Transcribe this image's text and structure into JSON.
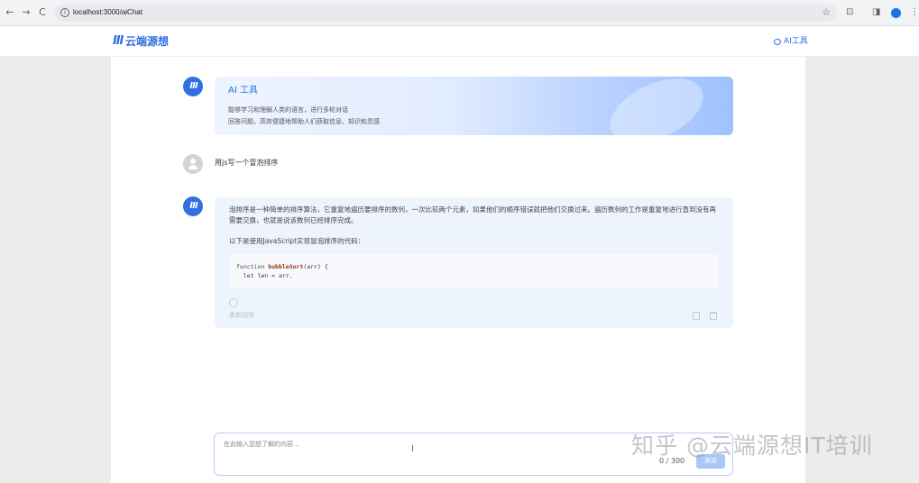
{
  "browser": {
    "url": "localhost:3000/aiChat",
    "back": "←",
    "forward": "→",
    "reload": "C",
    "info": "i",
    "star": "☆",
    "extensions": "⊡",
    "sidebar": "◨",
    "menu": "⋮"
  },
  "header": {
    "logo_mark": "Ⅲ",
    "logo_text": "云端源想",
    "nav_link": "AI工具"
  },
  "chat": {
    "ai_avatar": "Ⅲ",
    "intro": {
      "title": "AI 工具",
      "line1": "能够学习和理解人类的语言，进行多轮对话",
      "line2": "回答问题，高效便捷地帮助人们获取信息、知识和灵感"
    },
    "user_message": "用js写一个冒泡排序",
    "answer": {
      "paragraph1": "泡排序是一种简单的排序算法，它重复地遍历要排序的数列，一次比较两个元素，如果他们的顺序错误就把他们交换过来。遍历数列的工作是重复地进行直到没有再需要交换，也就是说该数列已经排序完成。",
      "paragraph2": "以下是使用JavaScript实现冒泡排序的代码：",
      "code_line1_kw": "function ",
      "code_line1_fn": "bubbleSort",
      "code_line1_rest": "(arr) {",
      "code_line2": "  let len = arr.",
      "regenerate": "重新回答"
    }
  },
  "input": {
    "placeholder": "在此输入您想了解的内容...",
    "value": "",
    "count": "0 / 300",
    "send": "发送",
    "cursor": "I"
  },
  "watermark": "知乎 @云端源想IT培训"
}
